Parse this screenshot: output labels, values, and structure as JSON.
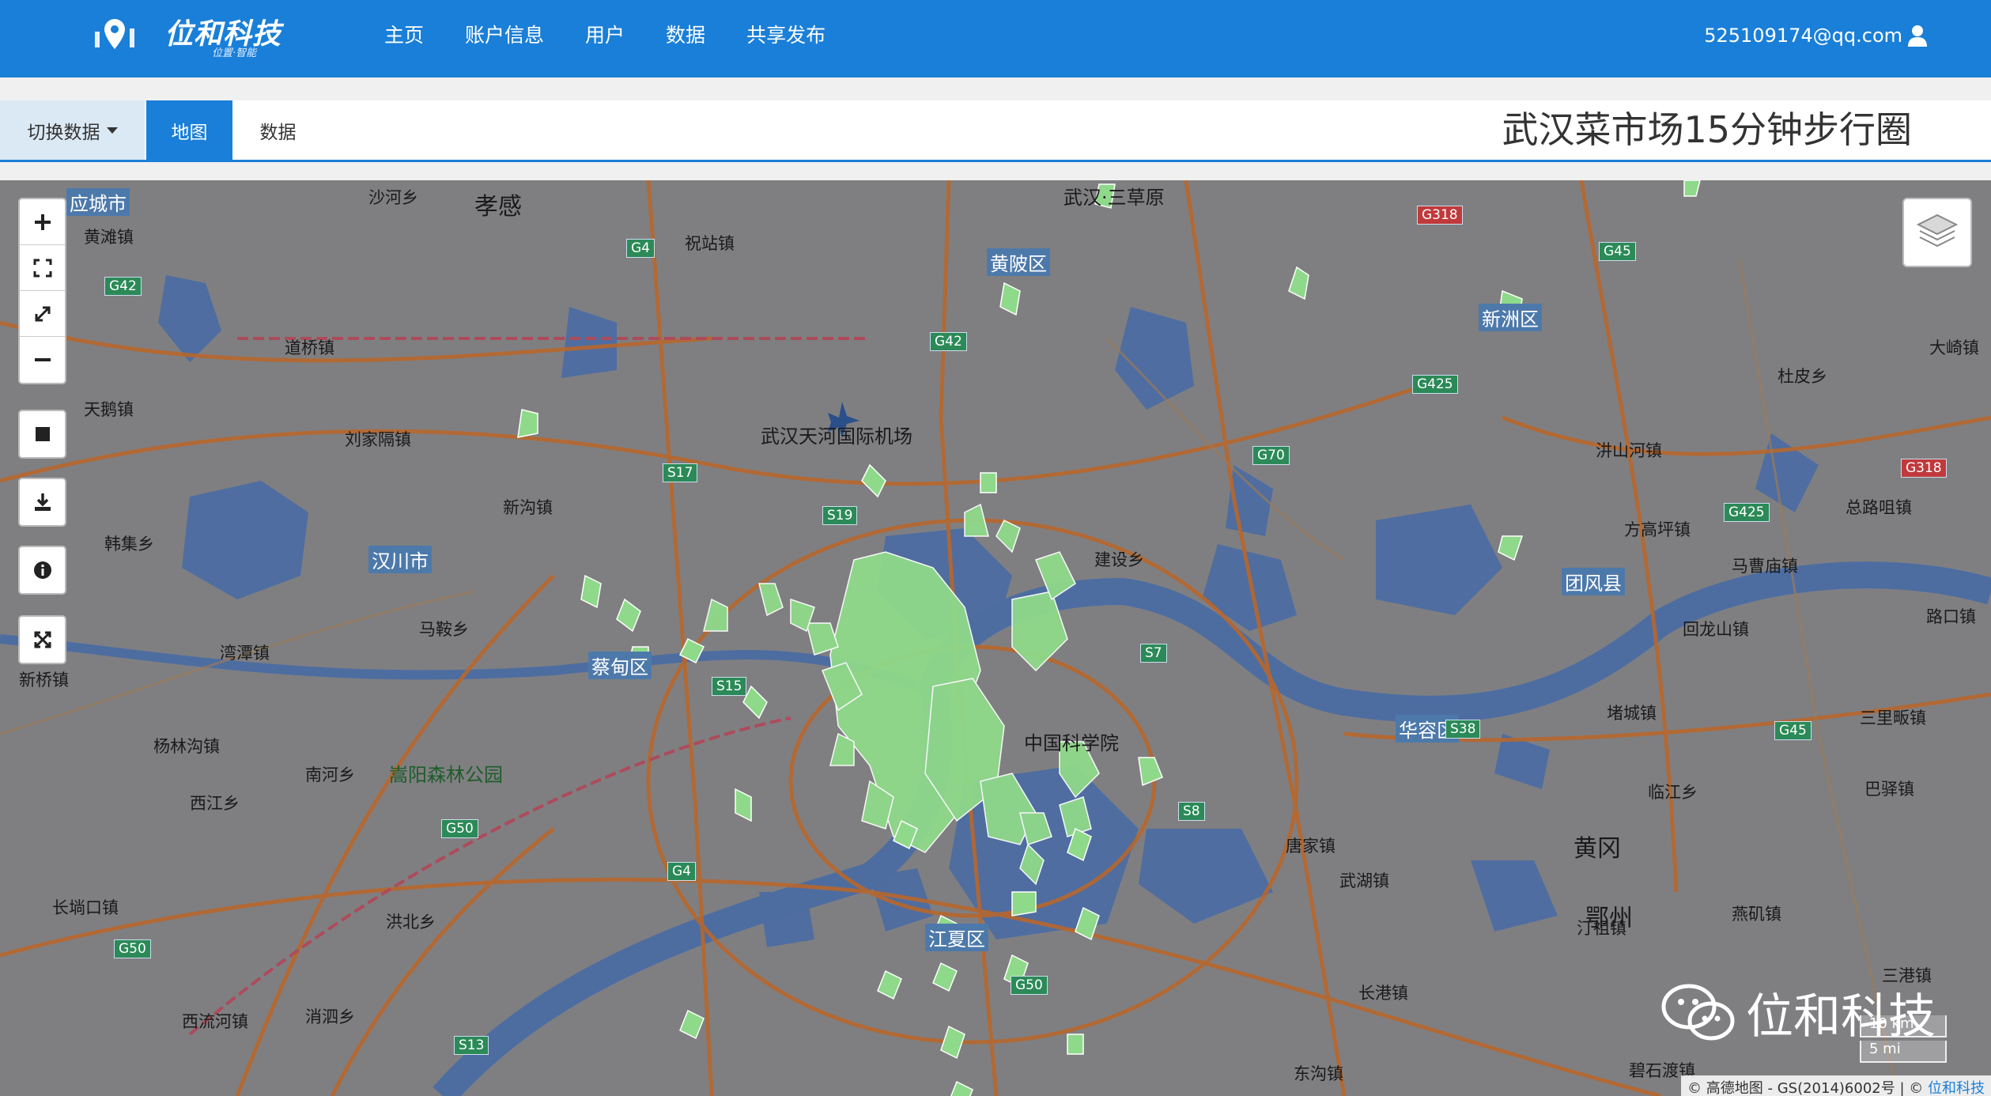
{
  "header": {
    "brand": "位和科技",
    "brand_sub": "位置·智能",
    "nav": [
      "主页",
      "账户信息",
      "用户",
      "数据",
      "共享发布"
    ],
    "account": "525109174@qq.com"
  },
  "toolbar": {
    "switch_label": "切换数据",
    "tab_map": "地图",
    "tab_data": "数据",
    "title": "武汉菜市场15分钟步行圈"
  },
  "map": {
    "labels": [
      {
        "id": "xiaogan",
        "text": "孝感"
      },
      {
        "id": "airport",
        "text": "武汉天河国际机场"
      },
      {
        "id": "zhongke",
        "text": "中国科学院"
      },
      {
        "id": "songyang",
        "text": "嵩阳森林公园"
      },
      {
        "id": "huanggang",
        "text": "黄冈"
      },
      {
        "id": "ezhou",
        "text": "鄂州"
      },
      {
        "id": "dawu",
        "text": "武汉·三草原"
      }
    ],
    "districts": [
      {
        "id": "huangpi",
        "text": "黄陂区"
      },
      {
        "id": "hanchuan",
        "text": "汉川市"
      },
      {
        "id": "caidian",
        "text": "蔡甸区"
      },
      {
        "id": "jiangxia",
        "text": "江夏区"
      },
      {
        "id": "tuanfeng",
        "text": "团风县"
      },
      {
        "id": "huarong",
        "text": "华容区"
      },
      {
        "id": "yingcheng",
        "text": "应城市"
      },
      {
        "id": "xinzhou",
        "text": "新洲区"
      }
    ],
    "towns": [
      "黄滩镇",
      "道桥镇",
      "天鹅镇",
      "刘家隔镇",
      "新沟镇",
      "韩集乡",
      "马鞍乡",
      "湾潭镇",
      "杨林沟镇",
      "南河乡",
      "西江乡",
      "长埫口镇",
      "洪北乡",
      "西流河镇",
      "消泗乡",
      "祝站镇",
      "建设乡",
      "沙河乡",
      "杜皮乡",
      "汫山河镇",
      "方高坪镇",
      "马曹庙镇",
      "回龙山镇",
      "堵城镇",
      "临江乡",
      "唐家镇",
      "武湖镇",
      "长港镇",
      "东沟镇",
      "碧石渡镇",
      "燕矶镇",
      "汀祖镇",
      "三港镇",
      "大崎镇",
      "总路咀镇",
      "巴驿镇",
      "路口镇",
      "三里畈镇",
      "新桥镇"
    ],
    "shields": [
      "G4",
      "G42",
      "G42",
      "G318",
      "G45",
      "G70",
      "G425",
      "G425",
      "G318",
      "S17",
      "S19",
      "S15",
      "S7",
      "S8",
      "G50",
      "G4",
      "G50",
      "S38",
      "G45",
      "S13",
      "G50"
    ],
    "icon_names": [
      "zoom-in-icon",
      "zoom-extent-icon",
      "full-extent-icon",
      "zoom-out-icon",
      "draw-rect-icon",
      "download-icon",
      "info-icon",
      "fullscreen-icon",
      "layers-icon",
      "wechat-icon"
    ]
  },
  "watermark": "位和科技",
  "scale": {
    "km": "10 km",
    "mi": "5 mi"
  },
  "attribution": {
    "text": "© 高德地图 - GS(2014)6002号 | ©",
    "link": "位和科技"
  },
  "colors": {
    "accent": "#1a7fd8",
    "polygon": "#8fd98a",
    "map_base": "#7f7f82"
  }
}
